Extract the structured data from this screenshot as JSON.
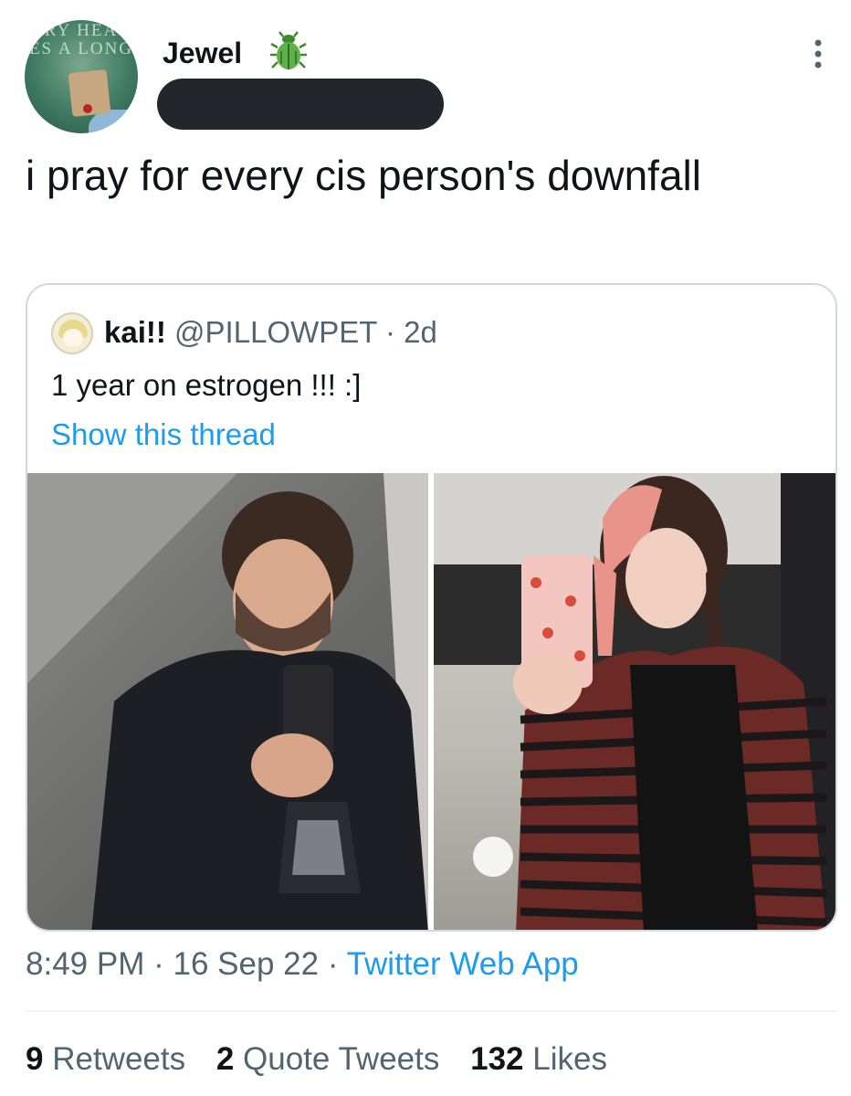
{
  "author": {
    "display_name": "Jewel",
    "handle": "",
    "avatar_overlay_text": "RY HEA\nES A LONG",
    "badge_icon": "beetle-icon",
    "badge_color": "#4ea03a"
  },
  "tweet": {
    "text": "i pray for every cis person's downfall"
  },
  "quoted_tweet": {
    "display_name": "kai!!",
    "handle": "@PILLOWPET",
    "separator": "·",
    "age": "2d",
    "text": "1 year on estrogen !!! :]",
    "thread_link": "Show this thread",
    "images": [
      {
        "name": "before-photo"
      },
      {
        "name": "after-photo"
      }
    ]
  },
  "meta": {
    "time": "8:49 PM",
    "separator": "·",
    "date": "16 Sep 22",
    "source": "Twitter Web App"
  },
  "stats": {
    "retweets_count": "9",
    "retweets_label": "Retweets",
    "quotes_count": "2",
    "quotes_label": "Quote Tweets",
    "likes_count": "132",
    "likes_label": "Likes"
  },
  "colors": {
    "text": "#0f1419",
    "secondary": "#536471",
    "link": "#1d9bf0",
    "border": "#cfd9de"
  }
}
